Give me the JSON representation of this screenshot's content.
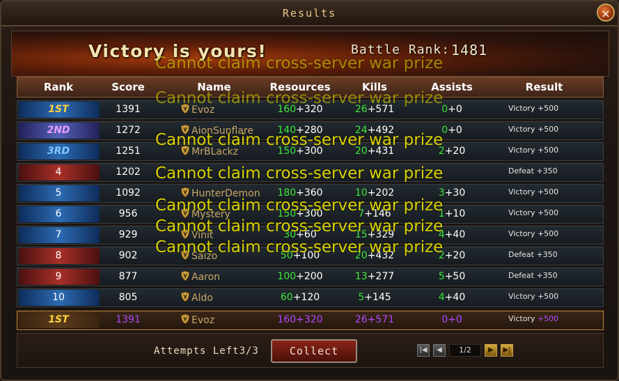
{
  "window": {
    "title": "Results",
    "close_icon": "×"
  },
  "banner": {
    "victory_text": "Victory is yours!",
    "battle_rank_label": "Battle Rank:",
    "battle_rank_value": "1481"
  },
  "table": {
    "headers": [
      "Rank",
      "Score",
      "Name",
      "Resources",
      "Kills",
      "Assists",
      "Result"
    ],
    "rows": [
      {
        "rank": "1ST",
        "score": "1391",
        "name": "Evoz",
        "res_a": "160",
        "res_b": "+320",
        "kills_a": "26",
        "kills_b": "+571",
        "assists_a": "0",
        "assists_b": "+0",
        "result_word": "Victory",
        "result_pts": "+500"
      },
      {
        "rank": "2ND",
        "score": "1272",
        "name": "AionSunflare",
        "res_a": "140",
        "res_b": "+280",
        "kills_a": "24",
        "kills_b": "+492",
        "assists_a": "0",
        "assists_b": "+0",
        "result_word": "Victory",
        "result_pts": "+500"
      },
      {
        "rank": "3RD",
        "score": "1251",
        "name": "MrBLackz",
        "res_a": "150",
        "res_b": "+300",
        "kills_a": "20",
        "kills_b": "+431",
        "assists_a": "2",
        "assists_b": "+20",
        "result_word": "Victory",
        "result_pts": "+500"
      },
      {
        "rank": "4",
        "score": "1202",
        "name": "",
        "res_a": "",
        "res_b": "",
        "kills_a": "",
        "kills_b": "",
        "assists_a": "",
        "assists_b": "",
        "result_word": "Defeat",
        "result_pts": "+350"
      },
      {
        "rank": "5",
        "score": "1092",
        "name": "HunterDemon",
        "res_a": "180",
        "res_b": "+360",
        "kills_a": "10",
        "kills_b": "+202",
        "assists_a": "3",
        "assists_b": "+30",
        "result_word": "Victory",
        "result_pts": "+500"
      },
      {
        "rank": "6",
        "score": "956",
        "name": "Mystery",
        "res_a": "150",
        "res_b": "+300",
        "kills_a": "7",
        "kills_b": "+146",
        "assists_a": "1",
        "assists_b": "+10",
        "result_word": "Victory",
        "result_pts": "+500"
      },
      {
        "rank": "7",
        "score": "929",
        "name": "Vinit",
        "res_a": "30",
        "res_b": "+60",
        "kills_a": "15",
        "kills_b": "+329",
        "assists_a": "4",
        "assists_b": "+40",
        "result_word": "Victory",
        "result_pts": "+500"
      },
      {
        "rank": "8",
        "score": "902",
        "name": "Saizo",
        "res_a": "50",
        "res_b": "+100",
        "kills_a": "20",
        "kills_b": "+432",
        "assists_a": "2",
        "assists_b": "+20",
        "result_word": "Defeat",
        "result_pts": "+350"
      },
      {
        "rank": "9",
        "score": "877",
        "name": "Aaron",
        "res_a": "100",
        "res_b": "+200",
        "kills_a": "13",
        "kills_b": "+277",
        "assists_a": "5",
        "assists_b": "+50",
        "result_word": "Defeat",
        "result_pts": "+350"
      },
      {
        "rank": "10",
        "score": "805",
        "name": "Aldo",
        "res_a": "60",
        "res_b": "+120",
        "kills_a": "5",
        "kills_b": "+145",
        "assists_a": "4",
        "assists_b": "+40",
        "result_word": "Victory",
        "result_pts": "+500"
      }
    ],
    "self_row": {
      "rank": "1ST",
      "score": "1391",
      "name": "Evoz",
      "res_a": "160",
      "res_b": "+320",
      "kills_a": "26",
      "kills_b": "+571",
      "assists_a": "0",
      "assists_b": "+0",
      "result_word": "Victory",
      "result_pts": "+500"
    }
  },
  "footer": {
    "attempts_label": "Attempts Left",
    "attempts_value": "3/3",
    "collect_label": "Collect",
    "page_indicator": "1/2"
  },
  "warning_message": "Cannot claim cross-server war prize",
  "colors": {
    "resources_green": "#3ee63e",
    "self_purple": "#b049ff",
    "warning_yellow": "#e8e000",
    "rank_gold": "#ffd23a"
  }
}
